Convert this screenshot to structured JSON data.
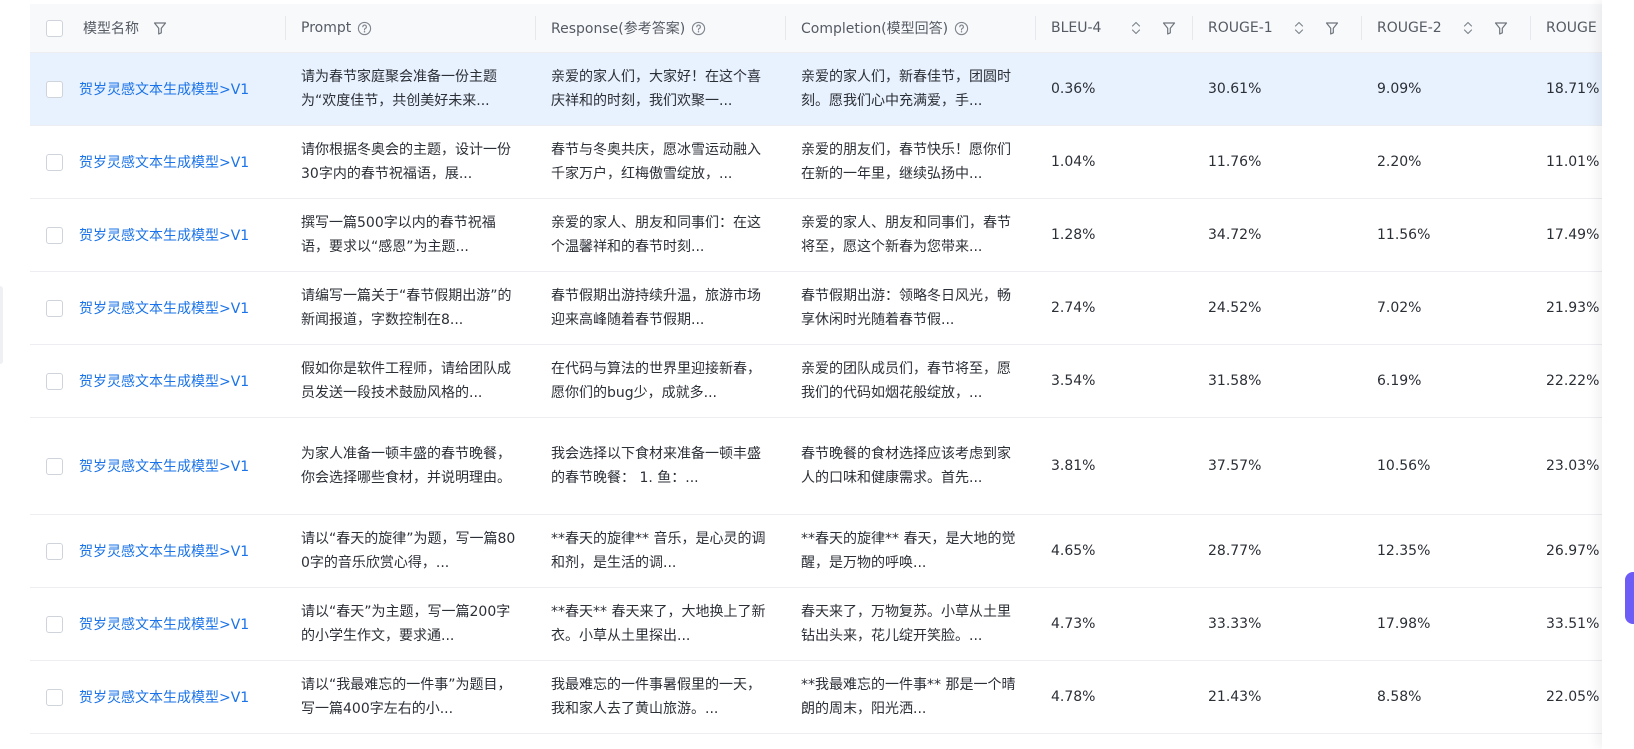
{
  "columns": {
    "model_name": "模型名称",
    "prompt": "Prompt",
    "response": "Response(参考答案)",
    "completion": "Completion(模型回答)",
    "bleu4": "BLEU-4",
    "rouge1": "ROUGE-1",
    "rouge2": "ROUGE-2",
    "rougel": "ROUGE"
  },
  "icons": {
    "filter": "filter-icon",
    "help": "help-circle-icon",
    "sort": "sort-updown-icon"
  },
  "colors": {
    "link": "#1a73e8",
    "selected_row": "#e8f1fe",
    "header_bg": "#f8f9fb",
    "accent_tab": "#6e5cf6"
  },
  "rows": [
    {
      "model": "贺岁灵感文本生成模型>V1",
      "prompt": "请为春节家庭聚会准备一份主题为“欢度佳节，共创美好未来...",
      "response": "亲爱的家人们，大家好！在这个喜庆祥和的时刻，我们欢聚一...",
      "completion": "亲爱的家人们，新春佳节，团圆时刻。愿我们心中充满爱，手...",
      "bleu4": "0.36%",
      "rouge1": "30.61%",
      "rouge2": "9.09%",
      "rougel": "18.71%"
    },
    {
      "model": "贺岁灵感文本生成模型>V1",
      "prompt": "请你根据冬奥会的主题，设计一份30字内的春节祝福语，展...",
      "response": "春节与冬奥共庆，愿冰雪运动融入千家万户，红梅傲雪绽放，...",
      "completion": "亲爱的朋友们，春节快乐！愿你们在新的一年里，继续弘扬中...",
      "bleu4": "1.04%",
      "rouge1": "11.76%",
      "rouge2": "2.20%",
      "rougel": "11.01%"
    },
    {
      "model": "贺岁灵感文本生成模型>V1",
      "prompt": "撰写一篇500字以内的春节祝福语，要求以“感恩”为主题...",
      "response": "亲爱的家人、朋友和同事们：在这个温馨祥和的春节时刻...",
      "completion": "亲爱的家人、朋友和同事们，春节将至，愿这个新春为您带来...",
      "bleu4": "1.28%",
      "rouge1": "34.72%",
      "rouge2": "11.56%",
      "rougel": "17.49%"
    },
    {
      "model": "贺岁灵感文本生成模型>V1",
      "prompt": "请编写一篇关于“春节假期出游”的新闻报道，字数控制在8...",
      "response": "春节假期出游持续升温，旅游市场迎来高峰随着春节假期...",
      "completion": "春节假期出游：领略冬日风光，畅享休闲时光随着春节假...",
      "bleu4": "2.74%",
      "rouge1": "24.52%",
      "rouge2": "7.02%",
      "rougel": "21.93%"
    },
    {
      "model": "贺岁灵感文本生成模型>V1",
      "prompt": "假如你是软件工程师，请给团队成员发送一段技术鼓励风格的...",
      "response": "在代码与算法的世界里迎接新春，愿你们的bug少，成就多...",
      "completion": "亲爱的团队成员们，春节将至，愿我们的代码如烟花般绽放，...",
      "bleu4": "3.54%",
      "rouge1": "31.58%",
      "rouge2": "6.19%",
      "rougel": "22.22%"
    },
    {
      "model": "贺岁灵感文本生成模型>V1",
      "prompt": "为家人准备一顿丰盛的春节晚餐，你会选择哪些食材，并说明理由。",
      "response": "我会选择以下食材来准备一顿丰盛的春节晚餐：  1. 鱼：...",
      "completion": "春节晚餐的食材选择应该考虑到家人的口味和健康需求。首先...",
      "bleu4": "3.81%",
      "rouge1": "37.57%",
      "rouge2": "10.56%",
      "rougel": "23.03%"
    },
    {
      "model": "贺岁灵感文本生成模型>V1",
      "prompt": "请以“春天的旋律”为题，写一篇800字的音乐欣赏心得，...",
      "response": "**春天的旋律** 音乐，是心灵的调和剂，是生活的调...",
      "completion": "**春天的旋律** 春天，是大地的觉醒，是万物的呼唤...",
      "bleu4": "4.65%",
      "rouge1": "28.77%",
      "rouge2": "12.35%",
      "rougel": "26.97%"
    },
    {
      "model": "贺岁灵感文本生成模型>V1",
      "prompt": "请以“春天”为主题，写一篇200字的小学生作文，要求通...",
      "response": "**春天** 春天来了，大地换上了新衣。小草从土里探出...",
      "completion": "春天来了，万物复苏。小草从土里钻出头来，花儿绽开笑脸。...",
      "bleu4": "4.73%",
      "rouge1": "33.33%",
      "rouge2": "17.98%",
      "rougel": "33.51%"
    },
    {
      "model": "贺岁灵感文本生成模型>V1",
      "prompt": "请以“我最难忘的一件事”为题目，写一篇400字左右的小...",
      "response": "我最难忘的一件事暑假里的一天，我和家人去了黄山旅游。...",
      "completion": "**我最难忘的一件事** 那是一个晴朗的周末，阳光洒...",
      "bleu4": "4.78%",
      "rouge1": "21.43%",
      "rouge2": "8.58%",
      "rougel": "22.05%"
    }
  ]
}
